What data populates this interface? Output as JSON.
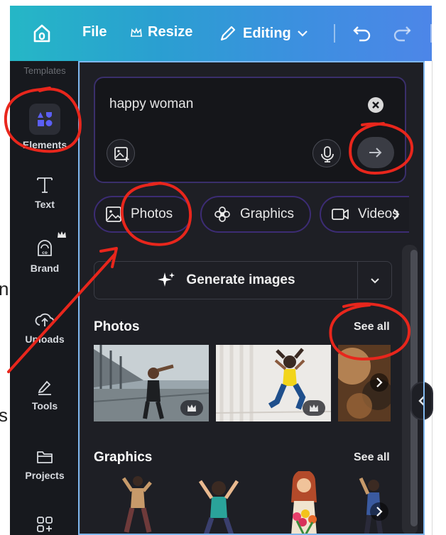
{
  "toolbar": {
    "file_label": "File",
    "resize_label": "Resize",
    "editing_label": "Editing"
  },
  "rail": {
    "faded_label": "Templates",
    "items": [
      {
        "label": "Elements"
      },
      {
        "label": "Text"
      },
      {
        "label": "Brand"
      },
      {
        "label": "Uploads"
      },
      {
        "label": "Tools"
      },
      {
        "label": "Projects"
      }
    ]
  },
  "search": {
    "value": "happy woman"
  },
  "chips": [
    {
      "label": "Photos"
    },
    {
      "label": "Graphics"
    },
    {
      "label": "Videos"
    }
  ],
  "generate": {
    "label": "Generate images"
  },
  "sections": {
    "photos_title": "Photos",
    "photos_see_all": "See all",
    "graphics_title": "Graphics",
    "graphics_see_all": "See all"
  },
  "left_bleed": [
    "n",
    "s"
  ],
  "colors": {
    "toolbar_start": "#25b7c6",
    "toolbar_end": "#4d86e8",
    "panel_bg": "#1e1f25",
    "rail_bg": "#17191e",
    "accent_purple": "#5b5ff5",
    "annotation_red": "#e8261c"
  }
}
